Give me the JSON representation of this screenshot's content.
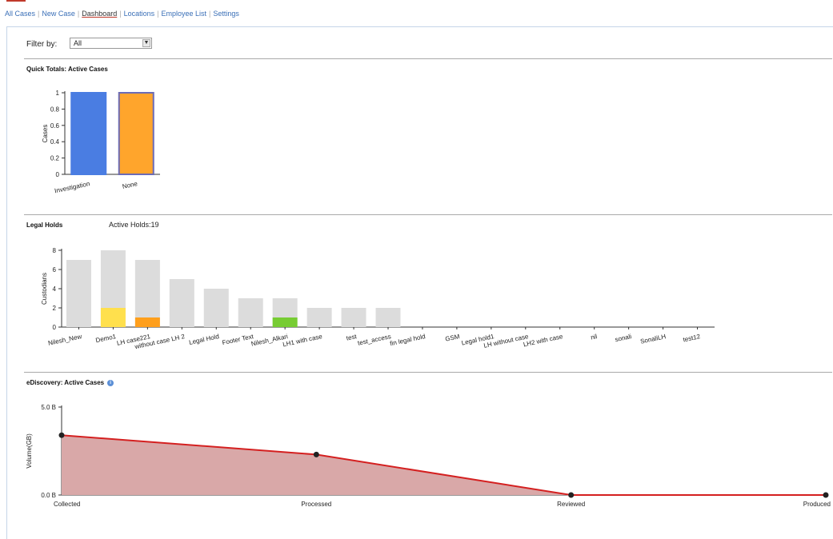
{
  "nav": {
    "items": [
      {
        "label": "All Cases",
        "active": false
      },
      {
        "label": "New Case",
        "active": false
      },
      {
        "label": "Dashboard",
        "active": true
      },
      {
        "label": "Locations",
        "active": false
      },
      {
        "label": "Employee List",
        "active": false
      },
      {
        "label": "Settings",
        "active": false
      }
    ],
    "separator": "|"
  },
  "filter": {
    "label": "Filter by:",
    "selected": "All"
  },
  "quick_totals": {
    "title": "Quick Totals: Active Cases"
  },
  "legal_holds": {
    "title": "Legal Holds",
    "active_holds": "Active Holds:19"
  },
  "ediscovery": {
    "title": "eDiscovery: Active Cases"
  },
  "colors": {
    "accent": "#c0392b",
    "link": "#3a6fb7",
    "investigation": "#4a7de2",
    "none": "#ffa52c",
    "none_border": "#6b6bb5",
    "gray_bar": "#dcdcdc",
    "yellow": "#ffe04d",
    "orange": "#ff9f1c",
    "green": "#77cc33",
    "area_fill": "#d9a8a8",
    "area_line": "#d42020"
  },
  "chart_data": [
    {
      "type": "bar",
      "title": "Quick Totals: Active Cases",
      "ylabel": "Cases",
      "xlabel": "",
      "categories": [
        "Investigation",
        "None"
      ],
      "values": [
        1,
        1
      ],
      "ylim": [
        0,
        1
      ],
      "yticks": [
        "0",
        "0.2",
        "0.4",
        "0.6",
        "0.8",
        "1"
      ],
      "grid": false
    },
    {
      "type": "bar",
      "title": "Legal Holds",
      "ylabel": "Custodians",
      "xlabel": "",
      "categories": [
        "Nilesh_New",
        "Demo1",
        "LH case221",
        "without case LH 2",
        "Legal Hold",
        "Footer Text",
        "Nilesh_Alkari",
        "LH1 with case",
        "test",
        "test_access",
        "fin legal hold",
        "GSM",
        "Legal hold1",
        "LH without case",
        "LH2 with case",
        "nil",
        "sonali",
        "SonaliLH",
        "test12"
      ],
      "series": [
        {
          "values": [
            7,
            8,
            7,
            5,
            4,
            3,
            3,
            2,
            2,
            2,
            0,
            0,
            0,
            0,
            0,
            0,
            0,
            0,
            0
          ]
        },
        {
          "values": [
            0,
            2,
            1,
            0,
            0,
            0,
            1,
            0,
            0,
            0,
            0,
            0,
            0,
            0,
            0,
            0,
            0,
            0,
            0
          ]
        }
      ],
      "ylim": [
        0,
        8
      ],
      "yticks": [
        "0",
        "2",
        "4",
        "6",
        "8"
      ],
      "grid": false
    },
    {
      "type": "area",
      "title": "eDiscovery: Active Cases",
      "ylabel": "Volume(GB)",
      "xlabel": "",
      "categories": [
        "Collected",
        "Processed",
        "Reviewed",
        "Produced"
      ],
      "values": [
        3.4,
        2.3,
        0,
        0
      ],
      "ylim": [
        0,
        5
      ],
      "yticks": [
        "0.0 B",
        "5.0 B"
      ],
      "grid": false
    }
  ]
}
